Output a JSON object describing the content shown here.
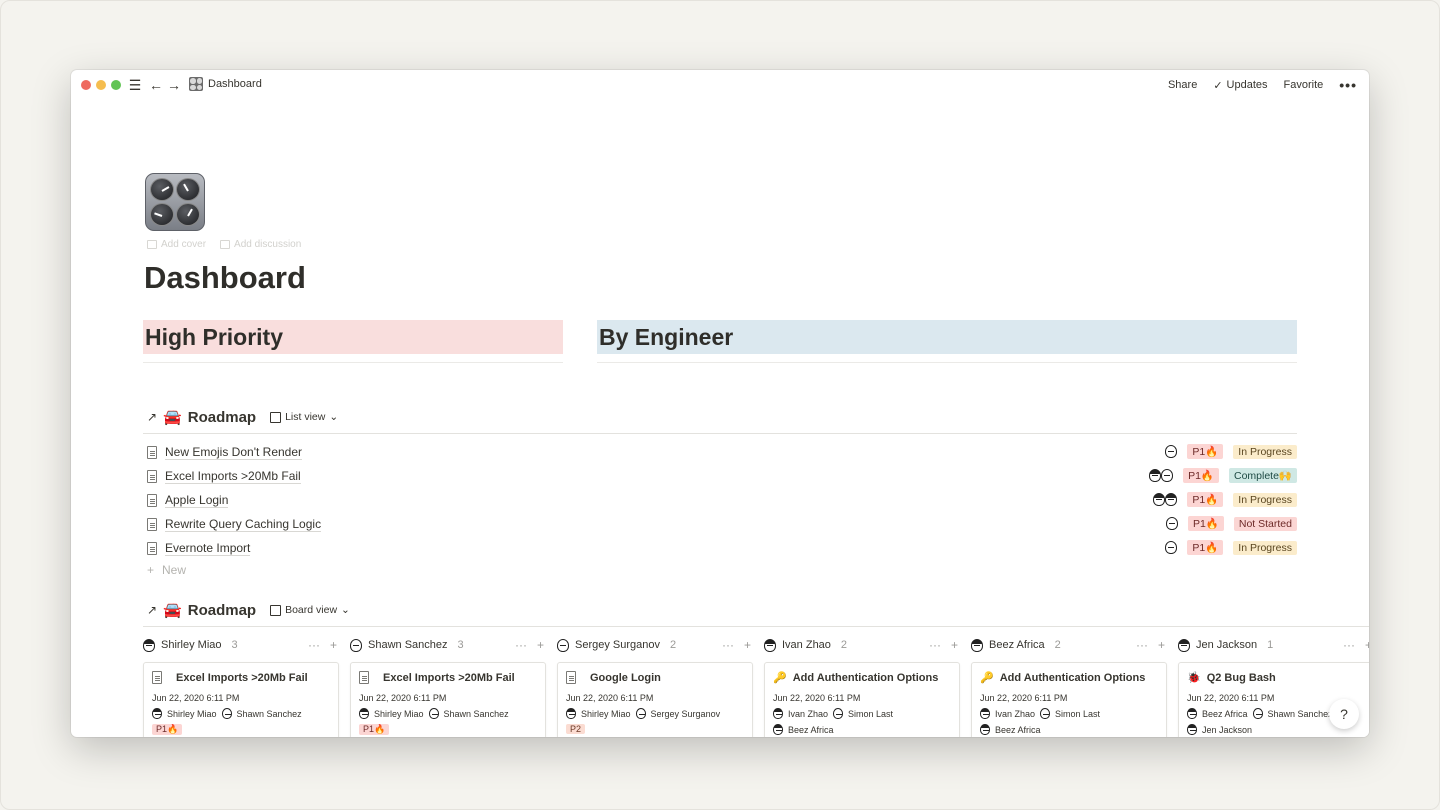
{
  "titlebar": {
    "breadcrumb": "Dashboard",
    "share": "Share",
    "updates": "Updates",
    "favorite": "Favorite",
    "more": "•••"
  },
  "page": {
    "add_cover": "Add cover",
    "add_discussion": "Add discussion",
    "title": "Dashboard"
  },
  "callouts": {
    "high_priority": "High Priority",
    "by_engineer": "By Engineer"
  },
  "list_db": {
    "arrow": "↗",
    "emoji": "🚘",
    "name": "Roadmap",
    "view": "List view",
    "rows": [
      {
        "title": "New Emojis Don't Render",
        "priority": "P1🔥",
        "status": "In Progress"
      },
      {
        "title": "Excel Imports >20Mb Fail",
        "priority": "P1🔥",
        "status": "Complete🙌"
      },
      {
        "title": "Apple Login",
        "priority": "P1🔥",
        "status": "In Progress"
      },
      {
        "title": "Rewrite Query Caching Logic",
        "priority": "P1🔥",
        "status": "Not Started"
      },
      {
        "title": "Evernote Import",
        "priority": "P1🔥",
        "status": "In Progress"
      }
    ],
    "new_label": "New"
  },
  "board_db": {
    "arrow": "↗",
    "emoji": "🚘",
    "name": "Roadmap",
    "view": "Board view",
    "columns": [
      {
        "name": "Shirley Miao",
        "count": "3",
        "card": {
          "title": "Excel Imports >20Mb Fail",
          "date": "Jun 22, 2020 6:11 PM",
          "person1": "Shirley Miao",
          "person2": "Shawn Sanchez",
          "extra": "P1🔥"
        }
      },
      {
        "name": "Shawn Sanchez",
        "count": "3",
        "card": {
          "title": "Excel Imports >20Mb Fail",
          "date": "Jun 22, 2020 6:11 PM",
          "person1": "Shirley Miao",
          "person2": "Shawn Sanchez",
          "extra": "P1🔥"
        }
      },
      {
        "name": "Sergey Surganov",
        "count": "2",
        "card": {
          "title": "Google Login",
          "date": "Jun 22, 2020 6:11 PM",
          "person1": "Shirley Miao",
          "person2": "Sergey Surganov",
          "extra": "P2"
        }
      },
      {
        "name": "Ivan Zhao",
        "count": "2",
        "card": {
          "title": "Add Authentication Options",
          "date": "Jun 22, 2020 6:11 PM",
          "person1": "Ivan Zhao",
          "person2": "Simon Last",
          "extra": "Beez Africa"
        }
      },
      {
        "name": "Beez Africa",
        "count": "2",
        "card": {
          "title": "Add Authentication Options",
          "date": "Jun 22, 2020 6:11 PM",
          "person1": "Ivan Zhao",
          "person2": "Simon Last",
          "extra": "Beez Africa"
        }
      },
      {
        "name": "Jen Jackson",
        "count": "1",
        "card": {
          "title": "Q2 Bug Bash",
          "date": "Jun 22, 2020 6:11 PM",
          "person1": "Beez Africa",
          "person2": "Shawn Sanchez",
          "extra": "Jen Jackson"
        }
      }
    ]
  },
  "help": "?"
}
